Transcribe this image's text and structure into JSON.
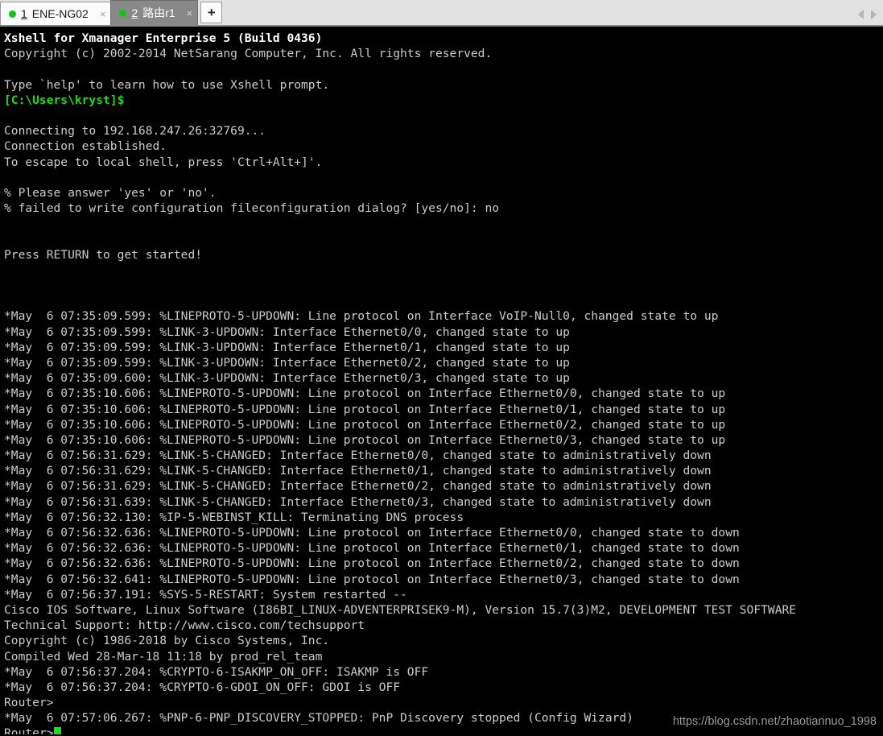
{
  "tabbar": {
    "tabs": [
      {
        "number": "1",
        "label": "ENE-NG02",
        "close": "×",
        "status": "connected"
      },
      {
        "number": "2",
        "label": "路由r1",
        "close": "×",
        "status": "connected"
      }
    ],
    "new_tab_label": "+",
    "nav_prev": "prev-tab",
    "nav_next": "next-tab",
    "active_index": 1,
    "bg_color": "#e2e2e2",
    "active_tab_color": "#888888",
    "status_dot_color": "#12c41a"
  },
  "terminal": {
    "bg_color": "#000000",
    "fg_color": "#cccccc",
    "prompt_color": "#18e018",
    "cursor_color": "#18e018",
    "lines": [
      {
        "text": "Xshell for Xmanager Enterprise 5 (Build 0436)",
        "style": "bold-white"
      },
      {
        "text": "Copyright (c) 2002-2014 NetSarang Computer, Inc. All rights reserved.",
        "style": "normal"
      },
      {
        "text": "",
        "style": "blank"
      },
      {
        "text": "Type `help' to learn how to use Xshell prompt.",
        "style": "normal"
      },
      {
        "text": "[C:\\Users\\kryst]$",
        "style": "green"
      },
      {
        "text": "",
        "style": "blank"
      },
      {
        "text": "Connecting to 192.168.247.26:32769...",
        "style": "normal"
      },
      {
        "text": "Connection established.",
        "style": "normal"
      },
      {
        "text": "To escape to local shell, press 'Ctrl+Alt+]'.",
        "style": "normal"
      },
      {
        "text": "",
        "style": "blank"
      },
      {
        "text": "% Please answer 'yes' or 'no'.",
        "style": "normal"
      },
      {
        "text": "% failed to write configuration fileconfiguration dialog? [yes/no]: no",
        "style": "normal"
      },
      {
        "text": "",
        "style": "blank"
      },
      {
        "text": "",
        "style": "blank"
      },
      {
        "text": "Press RETURN to get started!",
        "style": "normal"
      },
      {
        "text": "",
        "style": "blank"
      },
      {
        "text": "",
        "style": "blank"
      },
      {
        "text": "",
        "style": "blank"
      },
      {
        "text": "*May  6 07:35:09.599: %LINEPROTO-5-UPDOWN: Line protocol on Interface VoIP-Null0, changed state to up",
        "style": "normal"
      },
      {
        "text": "*May  6 07:35:09.599: %LINK-3-UPDOWN: Interface Ethernet0/0, changed state to up",
        "style": "normal"
      },
      {
        "text": "*May  6 07:35:09.599: %LINK-3-UPDOWN: Interface Ethernet0/1, changed state to up",
        "style": "normal"
      },
      {
        "text": "*May  6 07:35:09.599: %LINK-3-UPDOWN: Interface Ethernet0/2, changed state to up",
        "style": "normal"
      },
      {
        "text": "*May  6 07:35:09.600: %LINK-3-UPDOWN: Interface Ethernet0/3, changed state to up",
        "style": "normal"
      },
      {
        "text": "*May  6 07:35:10.606: %LINEPROTO-5-UPDOWN: Line protocol on Interface Ethernet0/0, changed state to up",
        "style": "normal"
      },
      {
        "text": "*May  6 07:35:10.606: %LINEPROTO-5-UPDOWN: Line protocol on Interface Ethernet0/1, changed state to up",
        "style": "normal"
      },
      {
        "text": "*May  6 07:35:10.606: %LINEPROTO-5-UPDOWN: Line protocol on Interface Ethernet0/2, changed state to up",
        "style": "normal"
      },
      {
        "text": "*May  6 07:35:10.606: %LINEPROTO-5-UPDOWN: Line protocol on Interface Ethernet0/3, changed state to up",
        "style": "normal"
      },
      {
        "text": "*May  6 07:56:31.629: %LINK-5-CHANGED: Interface Ethernet0/0, changed state to administratively down",
        "style": "normal"
      },
      {
        "text": "*May  6 07:56:31.629: %LINK-5-CHANGED: Interface Ethernet0/1, changed state to administratively down",
        "style": "normal"
      },
      {
        "text": "*May  6 07:56:31.629: %LINK-5-CHANGED: Interface Ethernet0/2, changed state to administratively down",
        "style": "normal"
      },
      {
        "text": "*May  6 07:56:31.639: %LINK-5-CHANGED: Interface Ethernet0/3, changed state to administratively down",
        "style": "normal"
      },
      {
        "text": "*May  6 07:56:32.130: %IP-5-WEBINST_KILL: Terminating DNS process",
        "style": "normal"
      },
      {
        "text": "*May  6 07:56:32.636: %LINEPROTO-5-UPDOWN: Line protocol on Interface Ethernet0/0, changed state to down",
        "style": "normal"
      },
      {
        "text": "*May  6 07:56:32.636: %LINEPROTO-5-UPDOWN: Line protocol on Interface Ethernet0/1, changed state to down",
        "style": "normal"
      },
      {
        "text": "*May  6 07:56:32.636: %LINEPROTO-5-UPDOWN: Line protocol on Interface Ethernet0/2, changed state to down",
        "style": "normal"
      },
      {
        "text": "*May  6 07:56:32.641: %LINEPROTO-5-UPDOWN: Line protocol on Interface Ethernet0/3, changed state to down",
        "style": "normal"
      },
      {
        "text": "*May  6 07:56:37.191: %SYS-5-RESTART: System restarted --",
        "style": "normal"
      },
      {
        "text": "Cisco IOS Software, Linux Software (I86BI_LINUX-ADVENTERPRISEK9-M), Version 15.7(3)M2, DEVELOPMENT TEST SOFTWARE",
        "style": "normal"
      },
      {
        "text": "Technical Support: http://www.cisco.com/techsupport",
        "style": "normal"
      },
      {
        "text": "Copyright (c) 1986-2018 by Cisco Systems, Inc.",
        "style": "normal"
      },
      {
        "text": "Compiled Wed 28-Mar-18 11:18 by prod_rel_team",
        "style": "normal"
      },
      {
        "text": "*May  6 07:56:37.204: %CRYPTO-6-ISAKMP_ON_OFF: ISAKMP is OFF",
        "style": "normal"
      },
      {
        "text": "*May  6 07:56:37.204: %CRYPTO-6-GDOI_ON_OFF: GDOI is OFF",
        "style": "normal"
      },
      {
        "text": "Router>",
        "style": "normal"
      },
      {
        "text": "*May  6 07:57:06.267: %PNP-6-PNP_DISCOVERY_STOPPED: PnP Discovery stopped (Config Wizard)",
        "style": "normal"
      }
    ],
    "prompt_line": "Router>"
  },
  "watermark": {
    "text": "https://blog.csdn.net/zhaotiannuo_1998",
    "color": "#9a9a9a"
  }
}
